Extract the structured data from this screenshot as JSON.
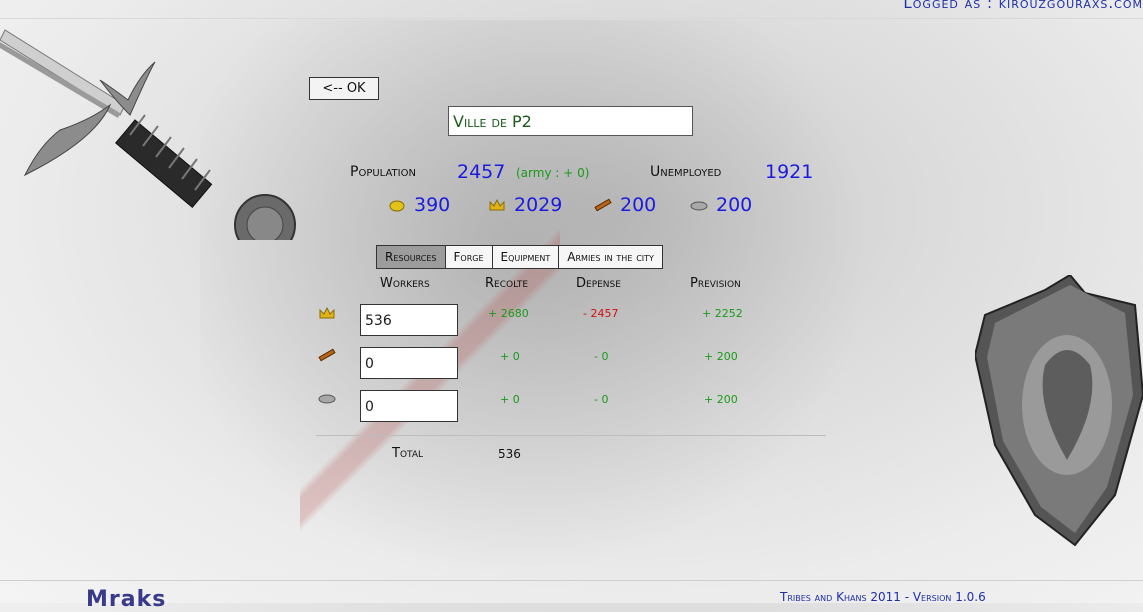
{
  "header": {
    "logged_as": "Logged as : kirouzgouraxs.com"
  },
  "nav": {
    "ok_label": "<-- OK"
  },
  "city": {
    "name": "Ville de P2"
  },
  "stats": {
    "population_label": "Population",
    "population_value": "2457",
    "army_text": "(army : + 0)",
    "unemployed_label": "Unemployed",
    "unemployed_value": "1921"
  },
  "resources": [
    {
      "icon": "gold-icon",
      "value": "390"
    },
    {
      "icon": "crown-icon",
      "value": "2029"
    },
    {
      "icon": "wood-icon",
      "value": "200"
    },
    {
      "icon": "stone-icon",
      "value": "200"
    }
  ],
  "tabs": [
    {
      "label": "Resources",
      "active": true
    },
    {
      "label": "Forge",
      "active": false
    },
    {
      "label": "Equipment",
      "active": false
    },
    {
      "label": "Armies in the city",
      "active": false
    }
  ],
  "columns": {
    "workers": "Workers",
    "recolte": "Recolte",
    "depense": "Depense",
    "prevision": "Prevision"
  },
  "rows": [
    {
      "icon": "crown-icon",
      "workers": "536",
      "recolte": "+ 2680",
      "depense": "- 2457",
      "prevision": "+ 2252"
    },
    {
      "icon": "wood-icon",
      "workers": "0",
      "recolte": "+ 0",
      "depense": "- 0",
      "prevision": "+ 200"
    },
    {
      "icon": "stone-icon",
      "workers": "0",
      "recolte": "+ 0",
      "depense": "- 0",
      "prevision": "+ 200"
    }
  ],
  "total": {
    "label": "Total",
    "value": "536"
  },
  "footer": {
    "logo": "Mraks",
    "text": "Tribes and Khans 2011    -    Version 1.0.6"
  },
  "colors": {
    "blue": "#1b1be0",
    "green": "#1a9a1a",
    "red": "#d01010"
  }
}
